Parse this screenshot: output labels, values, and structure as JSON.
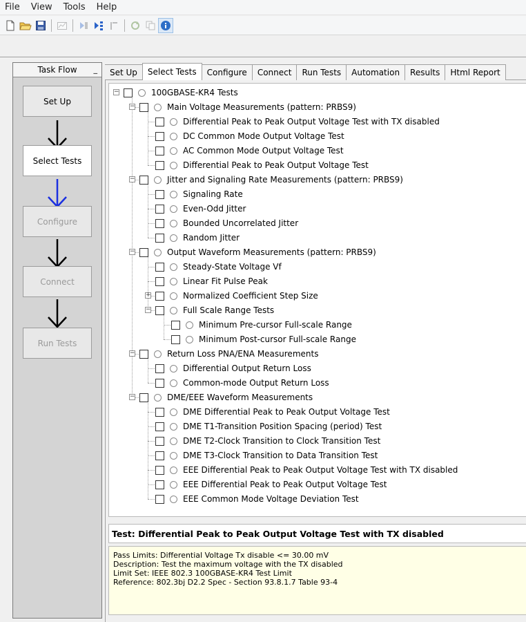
{
  "menu": [
    "File",
    "View",
    "Tools",
    "Help"
  ],
  "toolbar_icons": [
    "new-file-icon",
    "open-folder-icon",
    "save-icon",
    "chart-icon",
    "run-icon",
    "run-selected-icon",
    "stop-icon",
    "refresh-icon",
    "copy-icon",
    "info-icon"
  ],
  "taskflow": {
    "title": "Task Flow",
    "pin": "_",
    "steps": [
      {
        "label": "Set Up",
        "state": "normal"
      },
      {
        "label": "Select Tests",
        "state": "active"
      },
      {
        "label": "Configure",
        "state": "disabled"
      },
      {
        "label": "Connect",
        "state": "disabled"
      },
      {
        "label": "Run Tests",
        "state": "disabled"
      }
    ],
    "arrow_colors": [
      "#000000",
      "#1a2fe0",
      "#000000",
      "#000000"
    ]
  },
  "tabs": [
    {
      "label": "Set Up",
      "active": false
    },
    {
      "label": "Select Tests",
      "active": true
    },
    {
      "label": "Configure",
      "active": false
    },
    {
      "label": "Connect",
      "active": false
    },
    {
      "label": "Run Tests",
      "active": false
    },
    {
      "label": "Automation",
      "active": false
    },
    {
      "label": "Results",
      "active": false
    },
    {
      "label": "Html Report",
      "active": false
    }
  ],
  "tree": [
    {
      "level": 0,
      "label": "100GBASE-KR4 Tests",
      "exp": "-",
      "checked": false
    },
    {
      "level": 1,
      "label": "Main Voltage Measurements (pattern: PRBS9)",
      "exp": "-",
      "checked": false
    },
    {
      "level": 2,
      "label": "Differential Peak to Peak Output Voltage Test with TX disabled",
      "exp": "",
      "checked": false
    },
    {
      "level": 2,
      "label": "DC Common Mode Output Voltage Test",
      "exp": "",
      "checked": false
    },
    {
      "level": 2,
      "label": "AC Common Mode Output Voltage Test",
      "exp": "",
      "checked": false
    },
    {
      "level": 2,
      "label": "Differential Peak to Peak Output Voltage Test",
      "exp": "",
      "checked": false
    },
    {
      "level": 1,
      "label": "Jitter and Signaling Rate Measurements (pattern: PRBS9)",
      "exp": "-",
      "checked": false
    },
    {
      "level": 2,
      "label": "Signaling Rate",
      "exp": "",
      "checked": false
    },
    {
      "level": 2,
      "label": "Even-Odd Jitter",
      "exp": "",
      "checked": false
    },
    {
      "level": 2,
      "label": "Bounded Uncorrelated Jitter",
      "exp": "",
      "checked": false
    },
    {
      "level": 2,
      "label": "Random Jitter",
      "exp": "",
      "checked": false
    },
    {
      "level": 1,
      "label": "Output Waveform Measurements (pattern: PRBS9)",
      "exp": "-",
      "checked": false
    },
    {
      "level": 2,
      "label": "Steady-State Voltage Vf",
      "exp": "",
      "checked": false
    },
    {
      "level": 2,
      "label": "Linear Fit Pulse Peak",
      "exp": "",
      "checked": false
    },
    {
      "level": 2,
      "label": "Normalized Coefficient Step Size",
      "exp": "+",
      "checked": false
    },
    {
      "level": 2,
      "label": "Full Scale Range Tests",
      "exp": "-",
      "checked": false
    },
    {
      "level": 3,
      "label": "Minimum Pre-cursor Full-scale Range",
      "exp": "",
      "checked": false
    },
    {
      "level": 3,
      "label": "Minimum Post-cursor Full-scale Range",
      "exp": "",
      "checked": false
    },
    {
      "level": 1,
      "label": "Return Loss PNA/ENA Measurements",
      "exp": "-",
      "checked": false
    },
    {
      "level": 2,
      "label": "Differential Output Return Loss",
      "exp": "",
      "checked": false
    },
    {
      "level": 2,
      "label": "Common-mode Output Return Loss",
      "exp": "",
      "checked": false
    },
    {
      "level": 1,
      "label": "DME/EEE Waveform Measurements",
      "exp": "-",
      "checked": false
    },
    {
      "level": 2,
      "label": "DME Differential Peak to Peak Output Voltage Test",
      "exp": "",
      "checked": false
    },
    {
      "level": 2,
      "label": "DME T1-Transition Position Spacing (period) Test",
      "exp": "",
      "checked": false
    },
    {
      "level": 2,
      "label": "DME T2-Clock Transition to Clock Transition Test",
      "exp": "",
      "checked": false
    },
    {
      "level": 2,
      "label": "DME T3-Clock Transition to Data Transition Test",
      "exp": "",
      "checked": false
    },
    {
      "level": 2,
      "label": "EEE Differential Peak to Peak Output Voltage Test with TX disabled",
      "exp": "",
      "checked": false
    },
    {
      "level": 2,
      "label": "EEE Differential Peak to Peak Output Voltage Test",
      "exp": "",
      "checked": false
    },
    {
      "level": 2,
      "label": "EEE Common Mode Voltage Deviation Test",
      "exp": "",
      "checked": false
    }
  ],
  "info": {
    "title": "Test: Differential Peak to Peak Output Voltage Test with TX disabled",
    "lines": [
      "Pass Limits: Differential Voltage Tx disable <= 30.00 mV",
      "Description: Test the maximum voltage with the TX disabled",
      "Limit Set: IEEE 802.3 100GBASE-KR4 Test Limit",
      "Reference: 802.3bj D2.2 Spec - Section 93.8.1.7 Table 93-4"
    ]
  }
}
